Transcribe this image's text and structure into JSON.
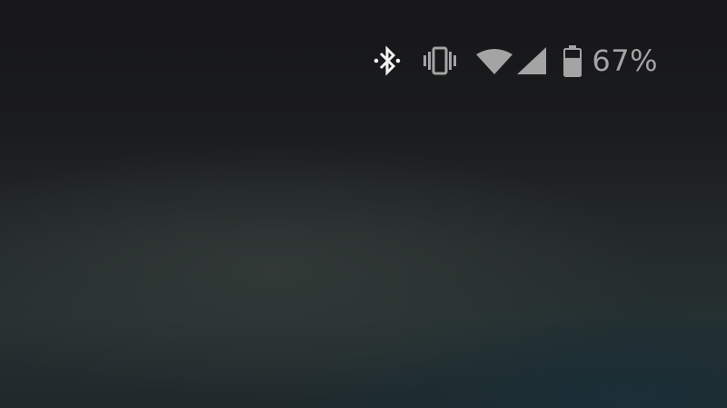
{
  "status_bar": {
    "icons": [
      "bluetooth-icon",
      "vibrate-icon",
      "wifi-icon",
      "cellular-signal-icon",
      "battery-icon"
    ],
    "battery_level_label": "67%",
    "battery_level": 0.67,
    "colors": {
      "bluetooth": "#f2f2f2",
      "muted_icons": "#a4a4a4"
    }
  }
}
